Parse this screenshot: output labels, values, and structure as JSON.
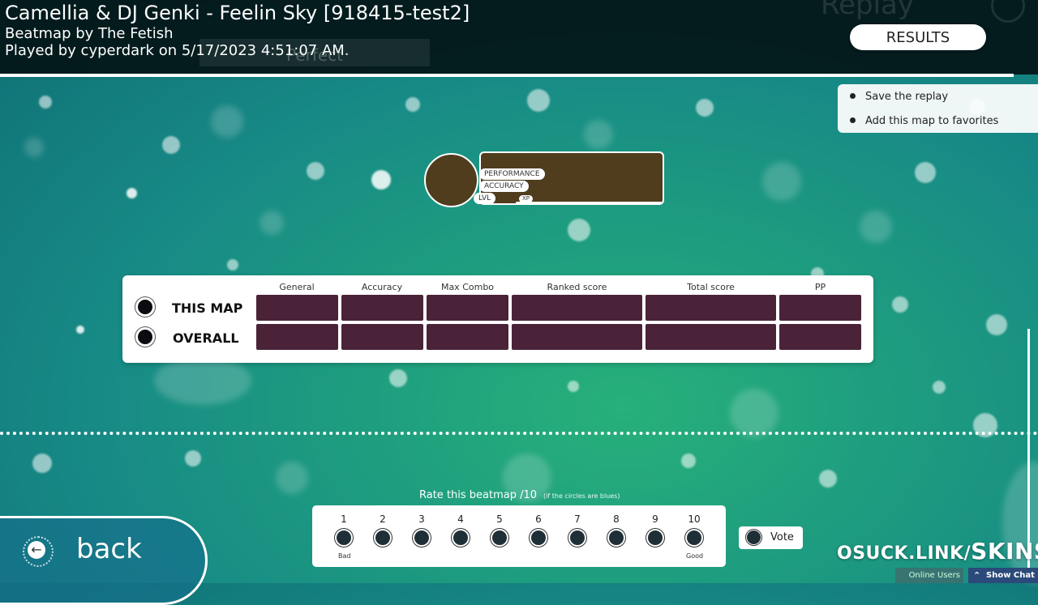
{
  "header": {
    "title": "Camellia & DJ Genki - Feelin Sky [918415-test2]",
    "beatmap_by": "Beatmap by The Fetish",
    "played_by": "Played by cyperdark on 5/17/2023 4:51:07 AM.",
    "ghost_title": "Replay",
    "ghost_box": "Perfect",
    "results_label": "RESULTS"
  },
  "side_menu": {
    "items": [
      {
        "label": "Save the replay"
      },
      {
        "label": "Add this map to favorites"
      }
    ]
  },
  "player_card": {
    "performance_label": "PERFORMANCE",
    "accuracy_label": "ACCURACY",
    "lvl_label": "LVL",
    "xp_label": "XP"
  },
  "stats": {
    "columns": [
      "General",
      "Accuracy",
      "Max Combo",
      "Ranked score",
      "Total score",
      "PP"
    ],
    "rows": [
      {
        "label": "THIS MAP"
      },
      {
        "label": "OVERALL"
      }
    ]
  },
  "rating": {
    "title": "Rate this beatmap /10",
    "hint": "(if the circles are blues)",
    "values": [
      "1",
      "2",
      "3",
      "4",
      "5",
      "6",
      "7",
      "8",
      "9",
      "10"
    ],
    "low_caption": "Bad",
    "high_caption": "Good",
    "vote_label": "Vote"
  },
  "back_label": "back",
  "skins_link_a": "OSUCK.LINK/",
  "skins_link_b": "SKINS",
  "online_users_label": "Online Users",
  "show_chat_label": "Show Chat"
}
